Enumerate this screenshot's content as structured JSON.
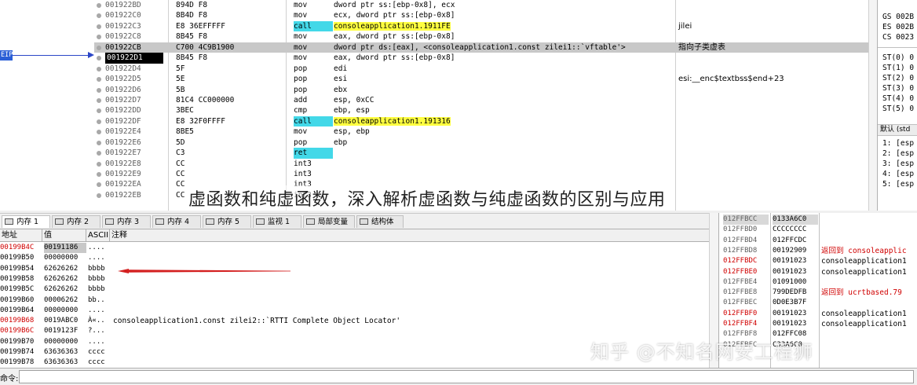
{
  "eip_label": "EIP",
  "disassembly": [
    {
      "addr": "001922BD",
      "bytes": "894D F8",
      "mnem": "mov",
      "ops": "dword ptr ss:[ebp-0x8], ecx",
      "cmt": ""
    },
    {
      "addr": "001922C0",
      "bytes": "8B4D F8",
      "mnem": "mov",
      "ops": "ecx, dword ptr ss:[ebp-0x8]",
      "cmt": ""
    },
    {
      "addr": "001922C3",
      "bytes": "E8 36EFFFFF",
      "mnem": "call",
      "ops": "consoleapplication1.1911FE",
      "cmt": "jilei"
    },
    {
      "addr": "001922C8",
      "bytes": "8B45 F8",
      "mnem": "mov",
      "ops": "eax, dword ptr ss:[ebp-0x8]",
      "cmt": ""
    },
    {
      "addr": "001922CB",
      "bytes": "C700 4C9B1900",
      "mnem": "mov",
      "ops": "dword ptr ds:[eax], <consoleapplication1.const zilei1::`vftable'>",
      "cmt": "指向子类虚表"
    },
    {
      "addr": "001922D1",
      "bytes": "8B45 F8",
      "mnem": "mov",
      "ops": "eax, dword ptr ss:[ebp-0x8]",
      "cmt": ""
    },
    {
      "addr": "001922D4",
      "bytes": "5F",
      "mnem": "pop",
      "ops": "edi",
      "cmt": ""
    },
    {
      "addr": "001922D5",
      "bytes": "5E",
      "mnem": "pop",
      "ops": "esi",
      "cmt": "esi:__enc$textbss$end+23"
    },
    {
      "addr": "001922D6",
      "bytes": "5B",
      "mnem": "pop",
      "ops": "ebx",
      "cmt": ""
    },
    {
      "addr": "001922D7",
      "bytes": "81C4 CC000000",
      "mnem": "add",
      "ops": "esp, 0xCC",
      "cmt": ""
    },
    {
      "addr": "001922DD",
      "bytes": "3BEC",
      "mnem": "cmp",
      "ops": "ebp, esp",
      "cmt": ""
    },
    {
      "addr": "001922DF",
      "bytes": "E8 32F0FFFF",
      "mnem": "call",
      "ops": "consoleapplication1.191316",
      "cmt": ""
    },
    {
      "addr": "001922E4",
      "bytes": "8BE5",
      "mnem": "mov",
      "ops": "esp, ebp",
      "cmt": ""
    },
    {
      "addr": "001922E6",
      "bytes": "5D",
      "mnem": "pop",
      "ops": "ebp",
      "cmt": ""
    },
    {
      "addr": "001922E7",
      "bytes": "C3",
      "mnem": "ret",
      "ops": "",
      "cmt": ""
    },
    {
      "addr": "001922E8",
      "bytes": "CC",
      "mnem": "int3",
      "ops": "",
      "cmt": ""
    },
    {
      "addr": "001922E9",
      "bytes": "CC",
      "mnem": "int3",
      "ops": "",
      "cmt": ""
    },
    {
      "addr": "001922EA",
      "bytes": "CC",
      "mnem": "int3",
      "ops": "",
      "cmt": ""
    },
    {
      "addr": "001922EB",
      "bytes": "CC",
      "mnem": "int3",
      "ops": "",
      "cmt": ""
    }
  ],
  "registers": {
    "segments": [
      "GS 002B",
      "ES 002B",
      "CS 0023"
    ],
    "fpu": [
      "ST(0) 0",
      "ST(1) 0",
      "ST(2) 0",
      "ST(3) 0",
      "ST(4) 0",
      "ST(5) 0"
    ],
    "default_label": "默认 (std",
    "args": [
      "1: [esp",
      "2: [esp",
      "3: [esp",
      "4: [esp",
      "5: [esp"
    ]
  },
  "overlay_title": "虚函数和纯虚函数，深入解析虚函数与纯虚函数的区别与应用",
  "tabs": [
    {
      "label": "内存 1",
      "active": true
    },
    {
      "label": "内存 2",
      "active": false
    },
    {
      "label": "内存 3",
      "active": false
    },
    {
      "label": "内存 4",
      "active": false
    },
    {
      "label": "内存 5",
      "active": false
    },
    {
      "label": "监视 1",
      "active": false
    },
    {
      "label": "局部变量",
      "active": false
    },
    {
      "label": "结构体",
      "active": false
    }
  ],
  "dump_headers": {
    "addr": "地址",
    "value": "值",
    "ascii": "ASCII",
    "comment": "注释"
  },
  "dump_rows": [
    {
      "addr": "00199B4C",
      "value": "00191186",
      "ascii": "....",
      "cmt": "",
      "red": true,
      "hl": true
    },
    {
      "addr": "00199B50",
      "value": "00000000",
      "ascii": "....",
      "cmt": "",
      "red": false,
      "hl": false
    },
    {
      "addr": "00199B54",
      "value": "62626262",
      "ascii": "bbbb",
      "cmt": "",
      "red": false,
      "hl": false
    },
    {
      "addr": "00199B58",
      "value": "62626262",
      "ascii": "bbbb",
      "cmt": "",
      "red": false,
      "hl": false
    },
    {
      "addr": "00199B5C",
      "value": "62626262",
      "ascii": "bbbb",
      "cmt": "",
      "red": false,
      "hl": false
    },
    {
      "addr": "00199B60",
      "value": "00006262",
      "ascii": "bb..",
      "cmt": "",
      "red": false,
      "hl": false
    },
    {
      "addr": "00199B64",
      "value": "00000000",
      "ascii": "....",
      "cmt": "",
      "red": false,
      "hl": false
    },
    {
      "addr": "00199B68",
      "value": "0019ABC0",
      "ascii": "À«..",
      "cmt": "consoleapplication1.const zilei2::`RTTI Complete Object Locator'",
      "red": true,
      "hl": false
    },
    {
      "addr": "00199B6C",
      "value": "0019123F",
      "ascii": "?...",
      "cmt": "",
      "red": true,
      "hl": false
    },
    {
      "addr": "00199B70",
      "value": "00000000",
      "ascii": "....",
      "cmt": "",
      "red": false,
      "hl": false
    },
    {
      "addr": "00199B74",
      "value": "63636363",
      "ascii": "cccc",
      "cmt": "",
      "red": false,
      "hl": false
    },
    {
      "addr": "00199B78",
      "value": "63636363",
      "ascii": "cccc",
      "cmt": "",
      "red": false,
      "hl": false
    }
  ],
  "stack_rows": [
    {
      "addr": "012FFBCC",
      "value": "0133A6C0",
      "cmt": "",
      "red": false,
      "cred": false,
      "top": true
    },
    {
      "addr": "012FFBD0",
      "value": "CCCCCCCC",
      "cmt": "",
      "red": false,
      "cred": false,
      "top": false
    },
    {
      "addr": "012FFBD4",
      "value": "012FFCDC",
      "cmt": "",
      "red": false,
      "cred": false,
      "top": false
    },
    {
      "addr": "012FFBD8",
      "value": "00192909",
      "cmt": "返回到 consoleapplic",
      "red": false,
      "cred": true,
      "top": false
    },
    {
      "addr": "012FFBDC",
      "value": "00191023",
      "cmt": "consoleapplication1",
      "red": true,
      "cred": false,
      "top": false
    },
    {
      "addr": "012FFBE0",
      "value": "00191023",
      "cmt": "consoleapplication1",
      "red": true,
      "cred": false,
      "top": false
    },
    {
      "addr": "012FFBE4",
      "value": "01091000",
      "cmt": "",
      "red": false,
      "cred": false,
      "top": false
    },
    {
      "addr": "012FFBE8",
      "value": "799DEDFB",
      "cmt": "返回到 ucrtbased.79",
      "red": false,
      "cred": true,
      "top": false
    },
    {
      "addr": "012FFBEC",
      "value": "0D0E3B7F",
      "cmt": "",
      "red": false,
      "cred": false,
      "top": false
    },
    {
      "addr": "012FFBF0",
      "value": "00191023",
      "cmt": "consoleapplication1",
      "red": true,
      "cred": false,
      "top": false
    },
    {
      "addr": "012FFBF4",
      "value": "00191023",
      "cmt": "consoleapplication1",
      "red": true,
      "cred": false,
      "top": false
    },
    {
      "addr": "012FFBF8",
      "value": "012FFC08",
      "cmt": "",
      "red": false,
      "cred": false,
      "top": false
    },
    {
      "addr": "012FFBFC",
      "value": "C33A6C0",
      "cmt": "",
      "red": false,
      "cred": false,
      "top": false
    }
  ],
  "command_label": "命令:",
  "command_value": "",
  "watermark": "知乎 @不知名网安工程狮",
  "colors": {
    "call_bg": "#43d8e8",
    "highlight_yellow": "#ffff40",
    "red_text": "#d00000",
    "eip_blue": "#2b5fd6",
    "arrow_red": "#d42020"
  }
}
